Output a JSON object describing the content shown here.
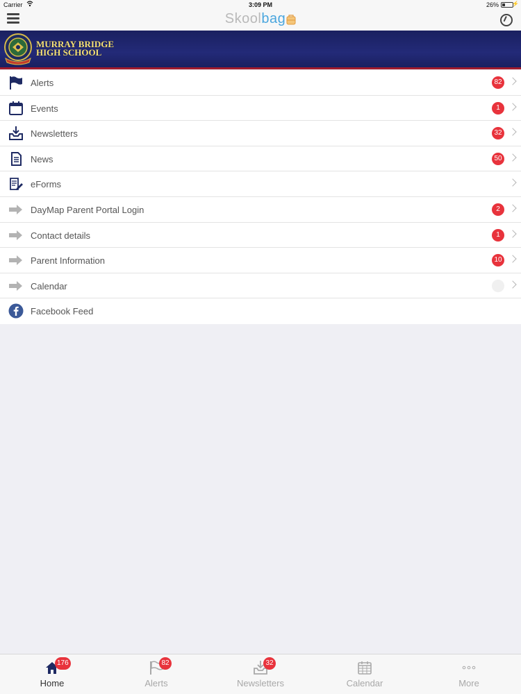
{
  "status_bar": {
    "carrier": "Carrier",
    "time": "3:09 PM",
    "battery": "26%"
  },
  "nav": {
    "logo_skool": "Skool",
    "logo_bag": "bag"
  },
  "school": {
    "name_line1": "MURRAY BRIDGE",
    "name_line2": "HIGH SCHOOL"
  },
  "menu": {
    "items": [
      {
        "label": "Alerts",
        "icon": "flag-icon",
        "badge": "82"
      },
      {
        "label": "Events",
        "icon": "calendar-icon",
        "badge": "1"
      },
      {
        "label": "Newsletters",
        "icon": "inbox-download-icon",
        "badge": "32"
      },
      {
        "label": "News",
        "icon": "document-icon",
        "badge": "50"
      },
      {
        "label": "eForms",
        "icon": "form-pencil-icon",
        "badge": ""
      },
      {
        "label": "DayMap Parent Portal Login",
        "icon": "arrow-right-icon",
        "badge": "2"
      },
      {
        "label": "Contact details",
        "icon": "arrow-right-icon",
        "badge": "1"
      },
      {
        "label": "Parent Information",
        "icon": "arrow-right-icon",
        "badge": "10"
      },
      {
        "label": "Calendar",
        "icon": "arrow-right-icon",
        "badge": ""
      },
      {
        "label": "Facebook Feed",
        "icon": "facebook-icon",
        "badge": ""
      }
    ]
  },
  "tabs": [
    {
      "label": "Home",
      "icon": "home-icon",
      "badge": "176",
      "active": true
    },
    {
      "label": "Alerts",
      "icon": "flag-icon",
      "badge": "82",
      "active": false
    },
    {
      "label": "Newsletters",
      "icon": "inbox-download-icon",
      "badge": "32",
      "active": false
    },
    {
      "label": "Calendar",
      "icon": "calendar-grid-icon",
      "badge": "",
      "active": false
    },
    {
      "label": "More",
      "icon": "more-dots-icon",
      "badge": "",
      "active": false
    }
  ],
  "colors": {
    "badge": "#e8333c",
    "banner": "#1f2670",
    "banner_stripe": "#a01b2d",
    "accent": "#4aa6de"
  }
}
